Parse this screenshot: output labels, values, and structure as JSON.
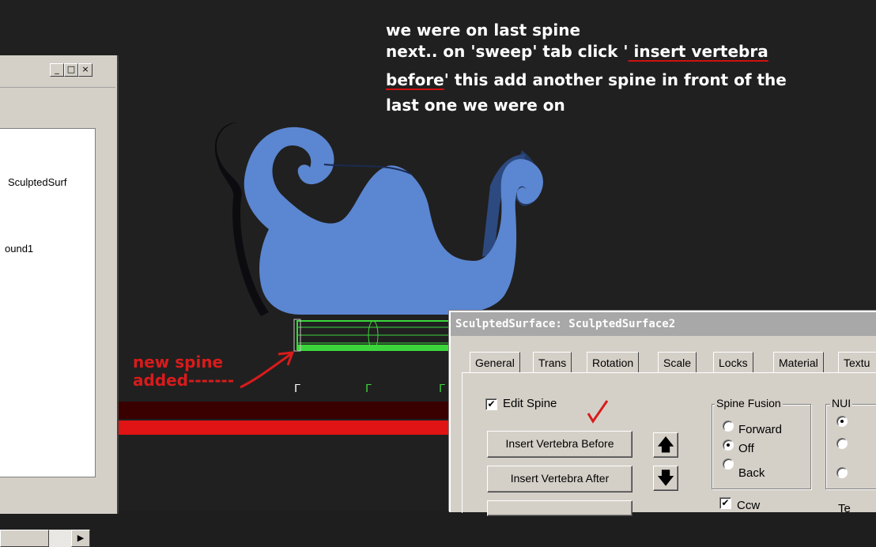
{
  "annotation": {
    "line1": "we were on last spine",
    "line2_prefix": "next.. on 'sweep' tab click '",
    "line2_underlined": " insert vertebra",
    "line3_underlined": "before",
    "line3_rest": "'  this add another spine in front of the",
    "line4": "last one we were on",
    "new_spine_line1": "new spine",
    "new_spine_line2": "added-------"
  },
  "left_window": {
    "list_item_1": "SculptedSurf",
    "list_item_2": "ound1",
    "scroll_right_arrow": "▶"
  },
  "dialog": {
    "title": "SculptedSurface: SculptedSurface2",
    "tabs": [
      "General",
      "Trans",
      "Rotation",
      "Scale",
      "Locks",
      "Material",
      "Textu"
    ],
    "edit_spine_label": "Edit Spine",
    "edit_spine_checked": "✔",
    "insert_before_label": "Insert Vertebra Before",
    "insert_after_label": "Insert Vertebra After",
    "up_arrow": "🡅",
    "down_arrow": "🡇",
    "spine_fusion": {
      "title": "Spine Fusion",
      "options": [
        "Forward",
        "Off",
        "Back"
      ],
      "selected": "Off"
    },
    "ccw_label": "Ccw",
    "ccw_checked": "✔",
    "nurbs_group_title": "NUI",
    "partial_label": "Te"
  },
  "colors": {
    "sleigh_blue": "#5b86d1",
    "annotation_red": "#d81b1b",
    "wire_green": "#3cd63c"
  }
}
